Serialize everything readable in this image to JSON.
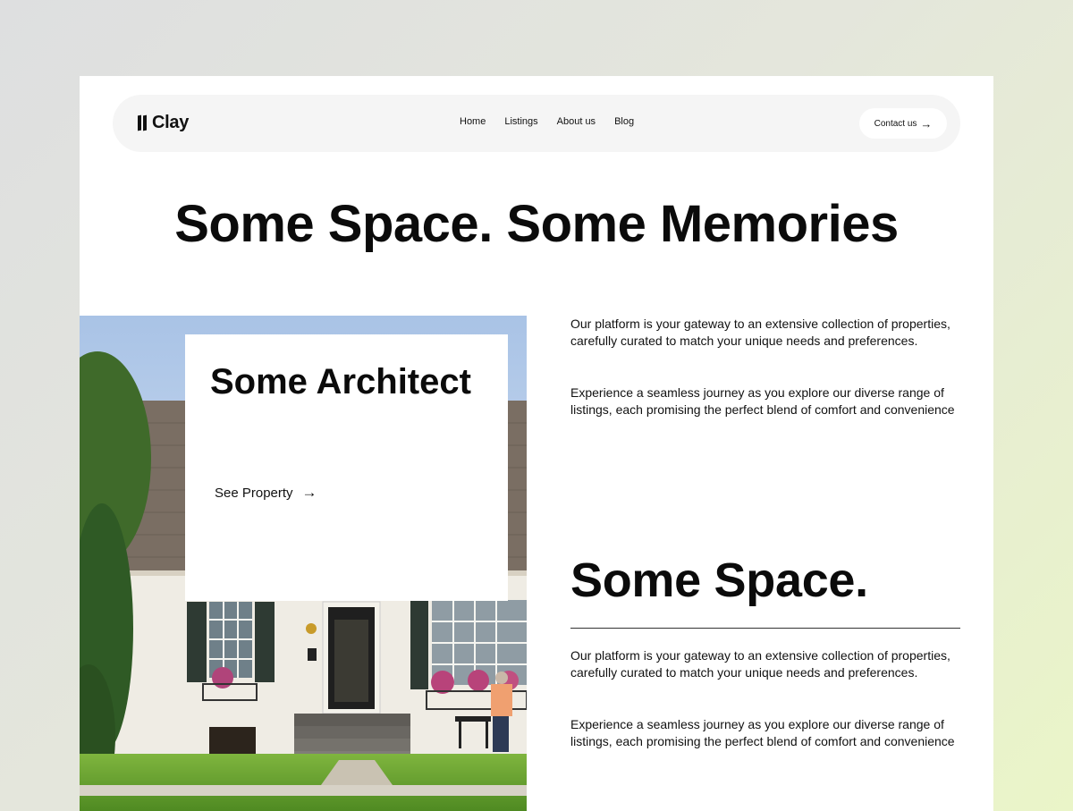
{
  "brand": {
    "name": "Clay"
  },
  "nav": {
    "links": [
      "Home",
      "Listings",
      "About us",
      "Blog"
    ],
    "contact_label": "Contact us"
  },
  "hero": {
    "title": "Some Space. Some Memories"
  },
  "card": {
    "title": "Some Architect",
    "cta_label": "See Property"
  },
  "content": {
    "para1": "Our platform is your gateway to an extensive collection of properties, carefully curated to match your unique needs and preferences.",
    "para2": "Experience a seamless journey as you explore our diverse range of listings, each promising the perfect blend of comfort and convenience",
    "subtitle": "Some Space.",
    "para3": "Our platform is your gateway to an extensive collection of properties, carefully curated to match your unique needs and preferences.",
    "para4": "Experience a seamless journey as you explore our diverse range of listings, each promising the perfect blend of comfort and convenience"
  },
  "colors": {
    "page_bg": "#ffffff",
    "nav_bg": "#f5f5f5",
    "text": "#111111"
  },
  "icons": [
    "logo-icon",
    "arrow-right-icon"
  ]
}
